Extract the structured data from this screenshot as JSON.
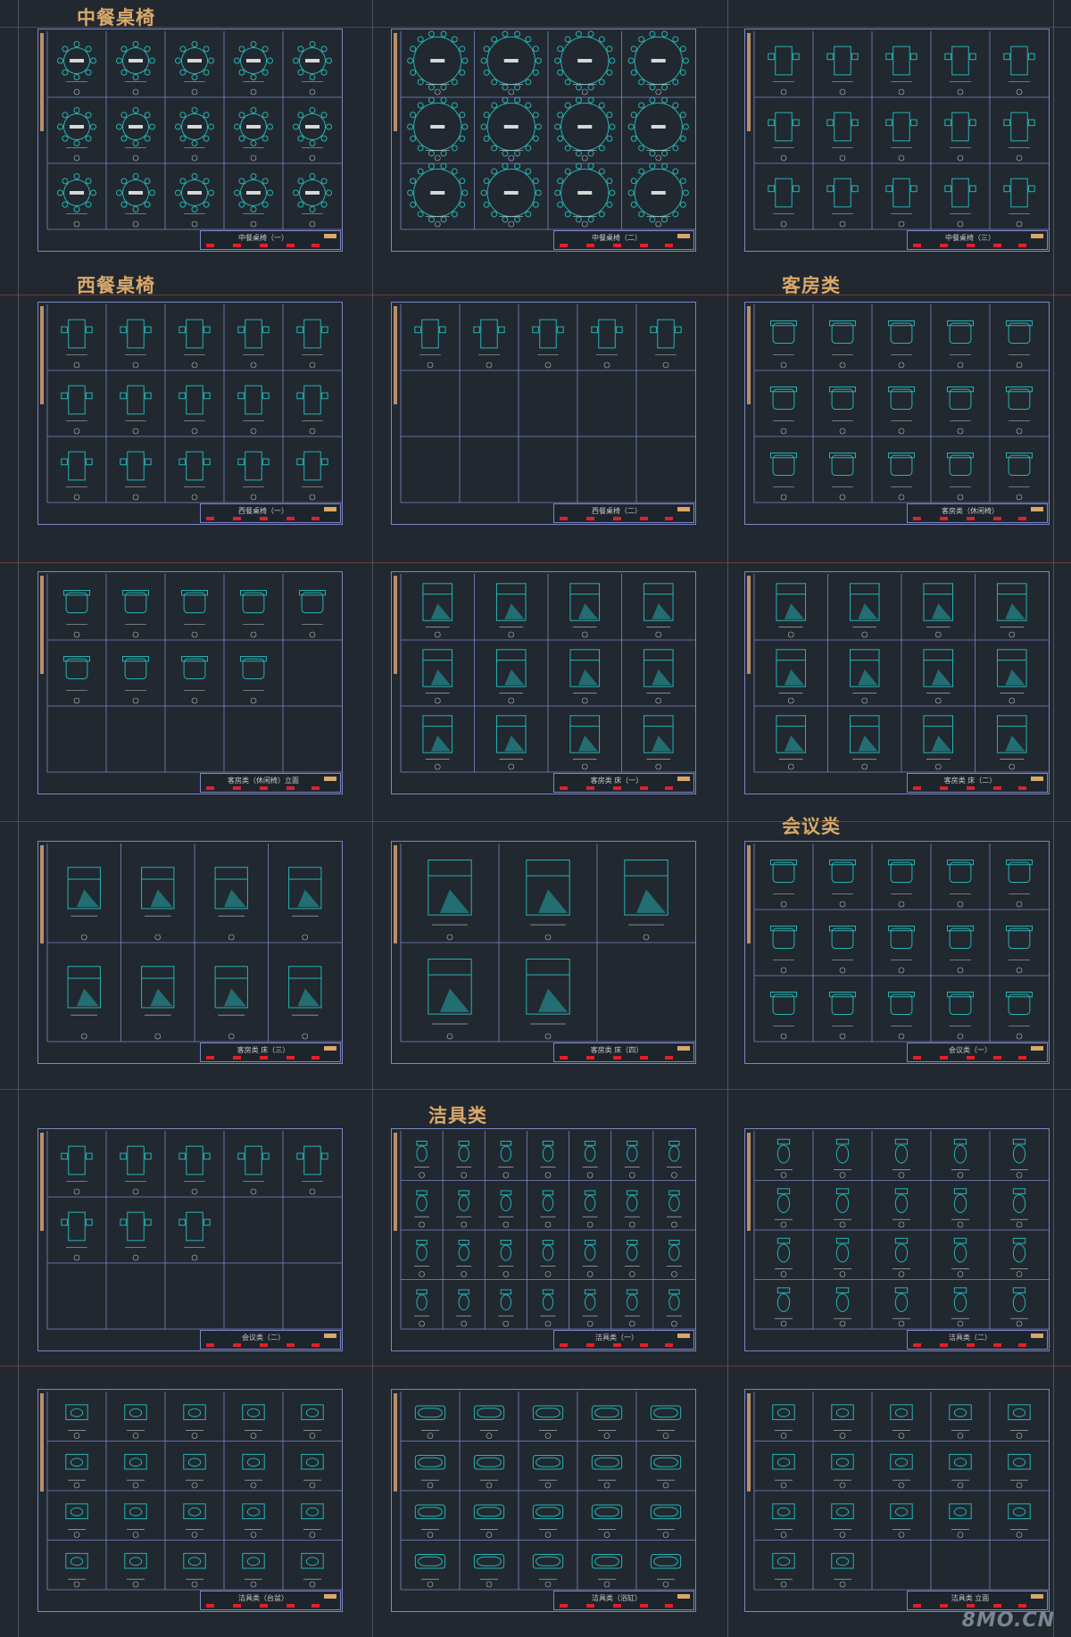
{
  "sections": [
    {
      "title": "中餐桌椅"
    },
    {
      "title": "西餐桌椅"
    },
    {
      "title": "客房类"
    },
    {
      "title": "会议类"
    },
    {
      "title": "洁具类"
    }
  ],
  "sheets": [
    {
      "label": "中餐桌椅（一）",
      "rows": 3,
      "cols": 5,
      "fill": 15,
      "shape": "round"
    },
    {
      "label": "中餐桌椅（二）",
      "rows": 3,
      "cols": 4,
      "fill": 12,
      "shape": "biground"
    },
    {
      "label": "中餐桌椅（三）",
      "rows": 3,
      "cols": 5,
      "fill": 15,
      "shape": "rect"
    },
    {
      "label": "西餐桌椅（一）",
      "rows": 3,
      "cols": 5,
      "fill": 15,
      "shape": "rect"
    },
    {
      "label": "西餐桌椅（二）",
      "rows": 3,
      "cols": 5,
      "fill": 5,
      "shape": "rect"
    },
    {
      "label": "客房类（休闲椅）",
      "rows": 3,
      "cols": 5,
      "fill": 15,
      "shape": "chair"
    },
    {
      "label": "客房类（休闲椅）立面",
      "rows": 3,
      "cols": 5,
      "fill": 9,
      "shape": "chair"
    },
    {
      "label": "客房类 床（一）",
      "rows": 3,
      "cols": 4,
      "fill": 12,
      "shape": "bed"
    },
    {
      "label": "客房类 床（二）",
      "rows": 3,
      "cols": 4,
      "fill": 12,
      "shape": "bed"
    },
    {
      "label": "客房类 床（三）",
      "rows": 2,
      "cols": 4,
      "fill": 8,
      "shape": "bed"
    },
    {
      "label": "客房类 床（四）",
      "rows": 2,
      "cols": 3,
      "fill": 5,
      "shape": "bed"
    },
    {
      "label": "会议类（一）",
      "rows": 3,
      "cols": 5,
      "fill": 15,
      "shape": "chair"
    },
    {
      "label": "会议类（二）",
      "rows": 3,
      "cols": 5,
      "fill": 8,
      "shape": "rect"
    },
    {
      "label": "洁具类（一）",
      "rows": 4,
      "cols": 7,
      "fill": 28,
      "shape": "toilet"
    },
    {
      "label": "洁具类（二）",
      "rows": 4,
      "cols": 5,
      "fill": 20,
      "shape": "toilet"
    },
    {
      "label": "洁具类（台盆）",
      "rows": 4,
      "cols": 5,
      "fill": 20,
      "shape": "basin"
    },
    {
      "label": "洁具类（浴缸）",
      "rows": 4,
      "cols": 5,
      "fill": 20,
      "shape": "tub"
    },
    {
      "label": "洁具类 立面",
      "rows": 4,
      "cols": 5,
      "fill": 17,
      "shape": "basin"
    }
  ],
  "watermark": "8MO.CN",
  "colors": {
    "background": "#212830",
    "frame": "#7d86c6",
    "symbol": "#26b3b3",
    "section_title": "#d9a86a",
    "red_mark": "#e0202a"
  }
}
